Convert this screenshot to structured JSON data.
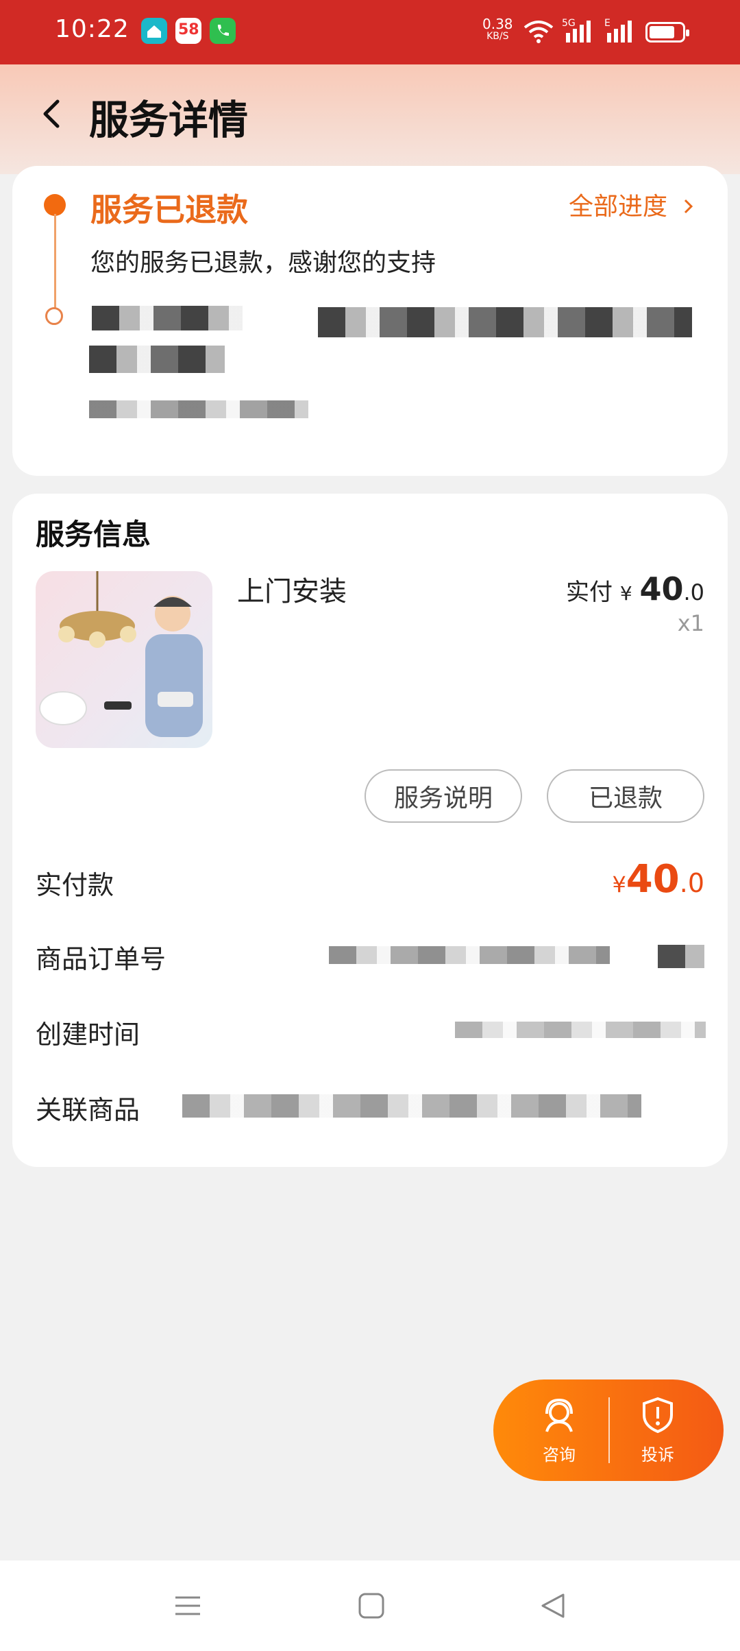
{
  "status_bar": {
    "time": "10:22",
    "app_icons": [
      "home-app-icon",
      "58-app-icon",
      "phone-app-icon"
    ],
    "app58_label": "58",
    "net_speed_value": "0.38",
    "net_speed_unit": "KB/S",
    "signal1_label": "5G",
    "signal2_label": "E"
  },
  "header": {
    "title": "服务详情"
  },
  "status_card": {
    "title": "服务已退款",
    "progress_link": "全部进度",
    "description": "您的服务已退款，感谢您的支持"
  },
  "service_info": {
    "section_title": "服务信息",
    "product_name": "上门安装",
    "price_prefix": "实付",
    "price_currency": "¥",
    "price_int": "40",
    "price_dec": ".0",
    "quantity": "x1",
    "btn_description": "服务说明",
    "btn_refunded": "已退款",
    "rows": {
      "paid_label": "实付款",
      "paid_currency": "¥",
      "paid_int": "40",
      "paid_dec": ".0",
      "order_label": "商品订单号",
      "created_label": "创建时间",
      "related_label": "关联商品"
    }
  },
  "float_actions": {
    "consult": "咨询",
    "complain": "投诉"
  },
  "colors": {
    "status_bar": "#d12a25",
    "accent": "#ea6a1b",
    "price": "#ea4a12",
    "float_start": "#ff8a0a",
    "float_end": "#f45a14"
  }
}
